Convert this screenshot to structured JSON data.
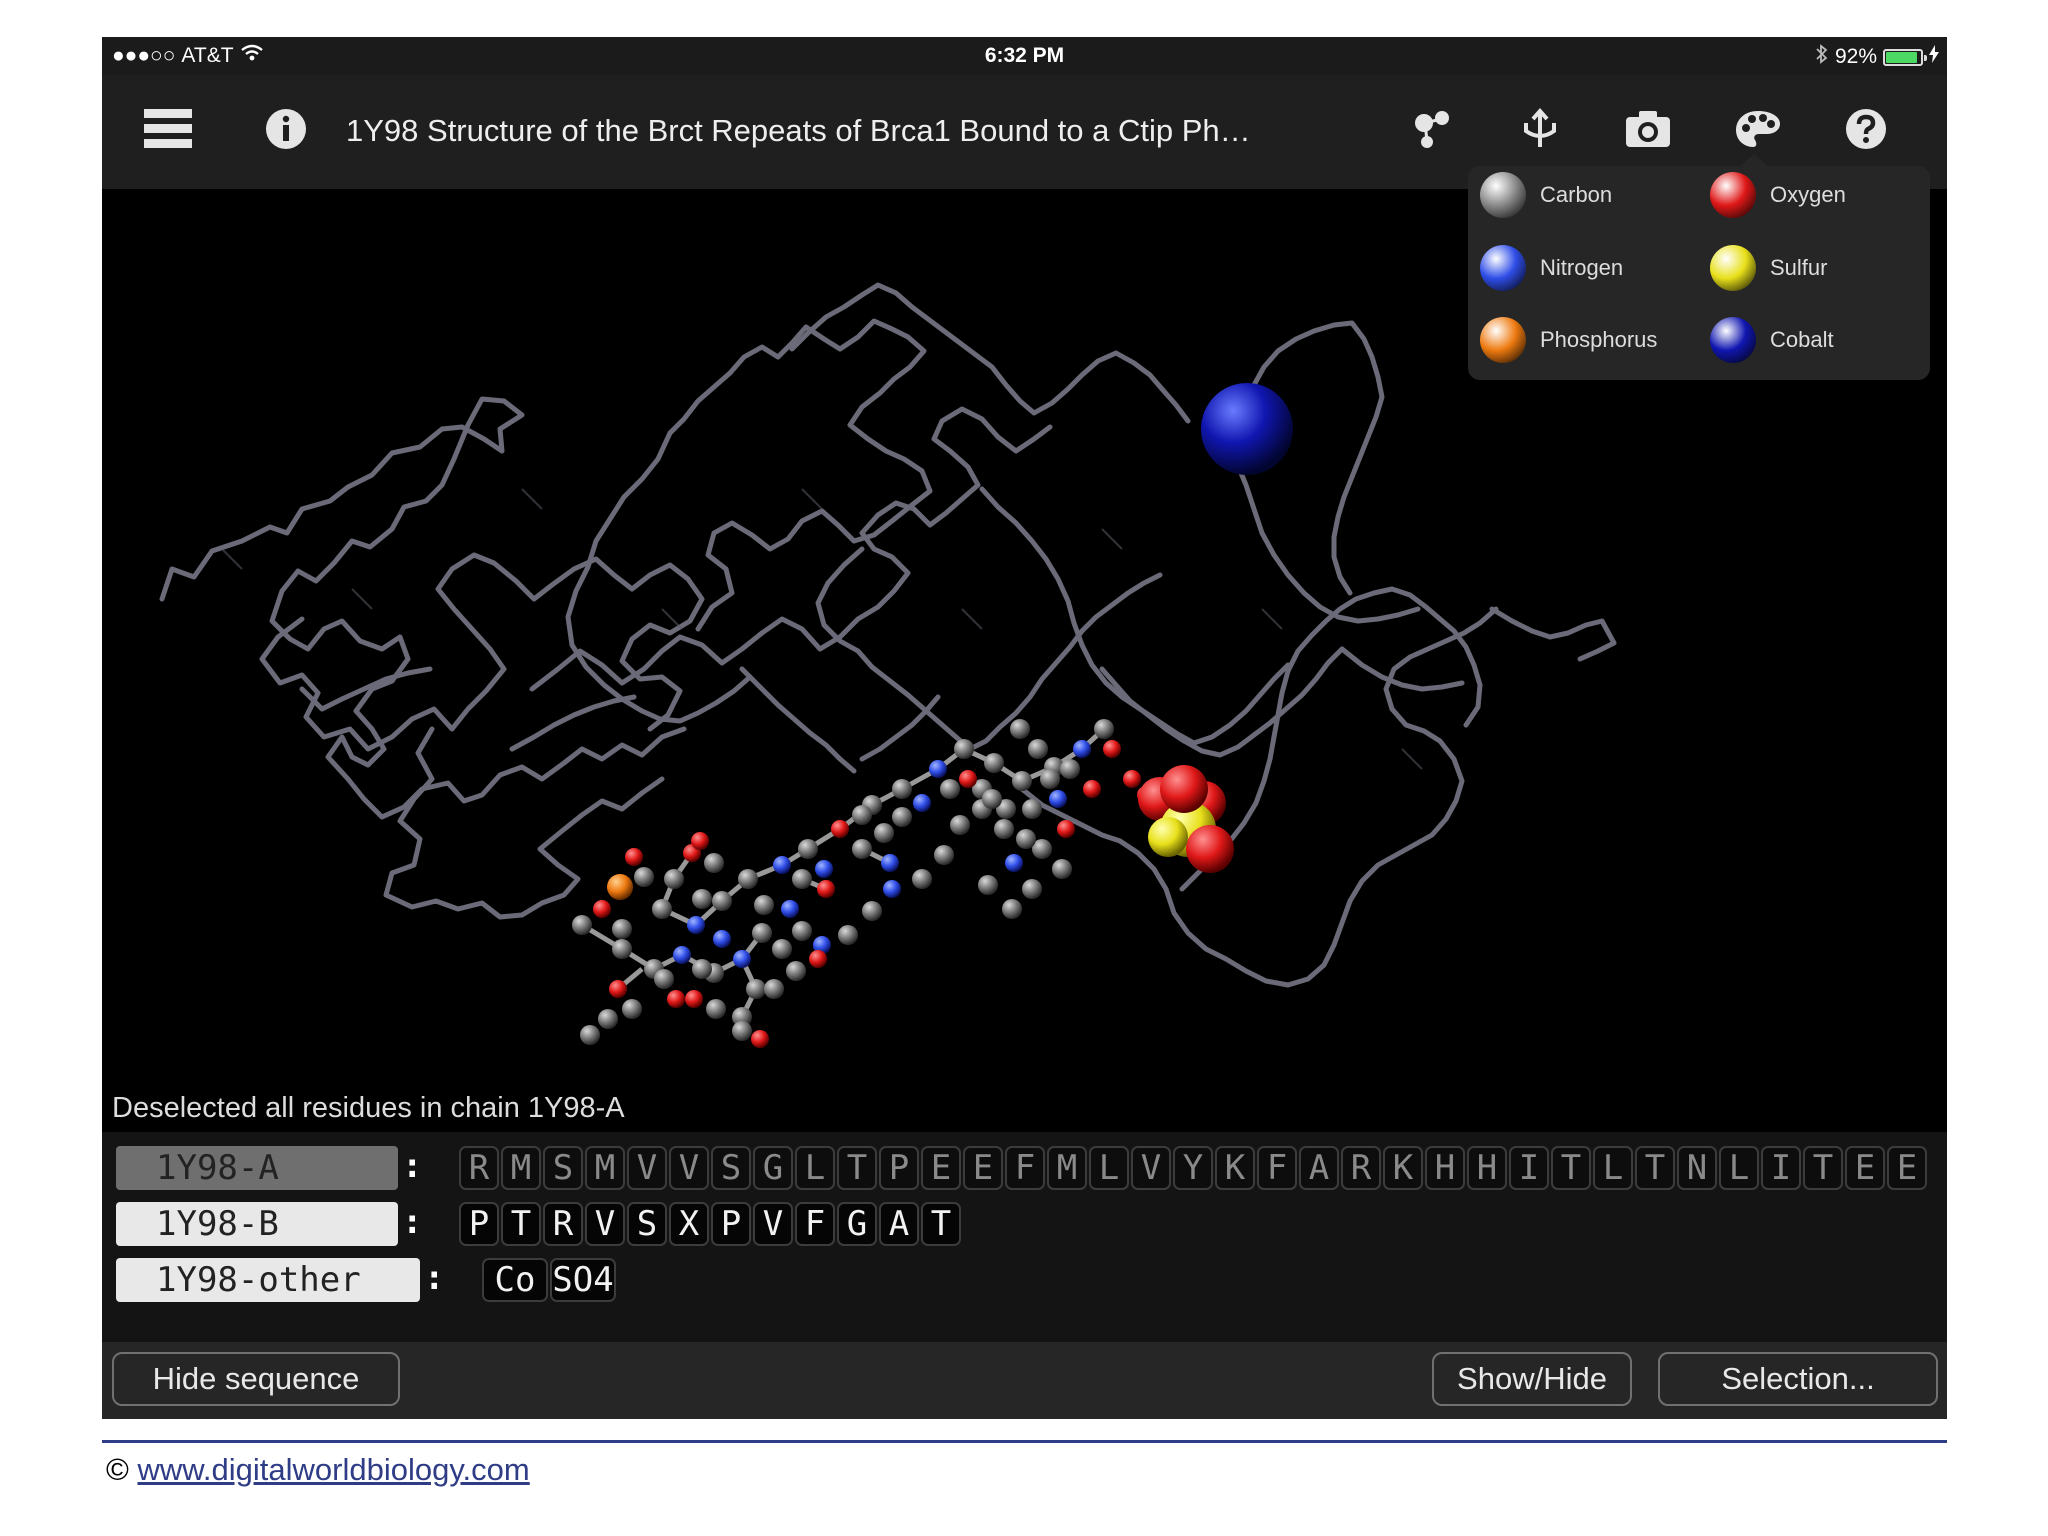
{
  "status_bar": {
    "signal": "●●●○○",
    "carrier": "AT&T",
    "time": "6:32 PM",
    "battery_text": "92%",
    "battery_level": 0.92
  },
  "toolbar": {
    "title": "1Y98 Structure of the Brct Repeats of Brca1 Bound to a Ctip Ph…",
    "icons": [
      "menu-icon",
      "info-icon",
      "molecule-style-icon",
      "dock-icon",
      "camera-icon",
      "palette-icon",
      "help-icon"
    ]
  },
  "legend": {
    "items": [
      {
        "label": "Carbon",
        "color": "#8a8a8a"
      },
      {
        "label": "Oxygen",
        "color": "#e01818"
      },
      {
        "label": "Nitrogen",
        "color": "#2f4ee8"
      },
      {
        "label": "Sulfur",
        "color": "#e8e01a"
      },
      {
        "label": "Phosphorus",
        "color": "#ee7a10"
      },
      {
        "label": "Cobalt",
        "color": "#1016b0"
      }
    ]
  },
  "message": "Deselected all residues in chain 1Y98-A",
  "sequence": {
    "chains": [
      {
        "label": "1Y98-A",
        "selected": true,
        "residues": [
          "R",
          "M",
          "S",
          "M",
          "V",
          "V",
          "S",
          "G",
          "L",
          "T",
          "P",
          "E",
          "E",
          "F",
          "M",
          "L",
          "V",
          "Y",
          "K",
          "F",
          "A",
          "R",
          "K",
          "H",
          "H",
          "I",
          "T",
          "L",
          "T",
          "N",
          "L",
          "I",
          "T",
          "E",
          "E"
        ]
      },
      {
        "label": "1Y98-B",
        "selected": false,
        "residues": [
          "P",
          "T",
          "R",
          "V",
          "S",
          "X",
          "P",
          "V",
          "F",
          "G",
          "A",
          "T"
        ]
      },
      {
        "label": "1Y98-other",
        "selected": false,
        "residues": [
          "Co",
          "SO4"
        ]
      }
    ],
    "separator": ":"
  },
  "bottom_bar": {
    "hide_sequence": "Hide sequence",
    "show_hide": "Show/Hide",
    "selection": "Selection..."
  },
  "footer": {
    "copyright": "©",
    "link_text": "www.digitalworldbiology.com"
  }
}
